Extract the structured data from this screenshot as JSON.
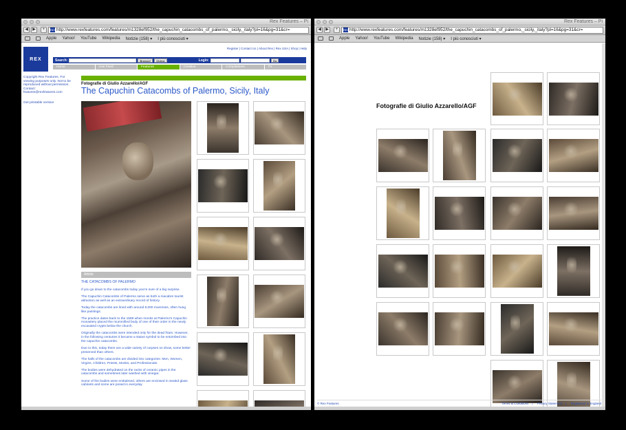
{
  "browser": {
    "title": "Rex Features – Pi",
    "back": "◀",
    "forward": "▶",
    "add": "+",
    "url_left": "http://www.rexfeatures.com/features/m1328ef952/the_capuchin_catacombs_of_palermo,_sicily,_italy?pl=16&pg=31&cr=",
    "url_right": "http://www.rexfeatures.com/features/m1328ef952/the_capuchin_catacombs_of_palermo,_sicily,_italy?pl=16&pg=31&cr=",
    "bookmarks": [
      "Apple",
      "Yahoo!",
      "YouTube",
      "Wikipedia",
      "Notizie (158) ▾",
      "I più conosciuti ▾"
    ]
  },
  "site": {
    "logo": "REX",
    "top_links": "Register | Contact Us | About Rex | Rex USA | Shop | Help",
    "search_label": "Search:",
    "search_btn1": "Browse!",
    "search_btn2": "Oldest",
    "login_label": "Login:",
    "go": "Go",
    "nav": [
      "Home",
      "Live Feed",
      "Features",
      "Creative",
      "Compilations",
      "TV"
    ],
    "copyright_note": "Copyright Rex Features. For viewing purposes only. Not to be reproduced without permission. Contact: features@rexfeatures.com",
    "printable": "Get printable version"
  },
  "feature": {
    "photographer": "Fotografie di Giulio Azzarello/AGF",
    "title": "The Capuchin Catacombs of Palermo, Sicily, Italy",
    "article_label": "Article",
    "article_heading": "THE CATACOMBS OF PALERMO",
    "paragraphs": [
      "If you go down to the catacombs today you're sure of a big surprise.",
      "The Capuchin Catacombs of Palermo serve as both a macabre tourist attraction as well as an extraordinary record of history.",
      "Today the catacombs are lined with around 8,000 mummies, often hung like paintings.",
      "The practice dates back to the 1599 when monks at Palermo's Capuchin monastery placed the mummified body of one of their order in the newly excavated crypts below the church.",
      "Originally the catacombs were intended only for the dead friars. However, in the following centuries it became a status symbol to be entombed into the capuchin catacombs.",
      "Due to this, today there are a wide variety of corpses on show, some better preserved than others.",
      "The halls of the catacombs are divided into categories: Men, Women, Virgins, Children, Priests, Monks, and Professionals.",
      "The bodies were dehydrated on the racks of ceramic pipes in the catacombs and sometimes later washed with vinegar.",
      "Some of the bodies were embalmed, others are enclosed in sealed glass cabinets and some are posed in everyday"
    ]
  },
  "footer": {
    "copyright": "© Rex Features",
    "links": [
      "Terms & Conditions",
      "Privacy Statement",
      "Registered in England"
    ]
  },
  "colors": {
    "brand_blue": "#1b3b9c",
    "nav_green": "#6ab000",
    "link_blue": "#2a57c8",
    "nav_grey": "#bdbdbd"
  }
}
